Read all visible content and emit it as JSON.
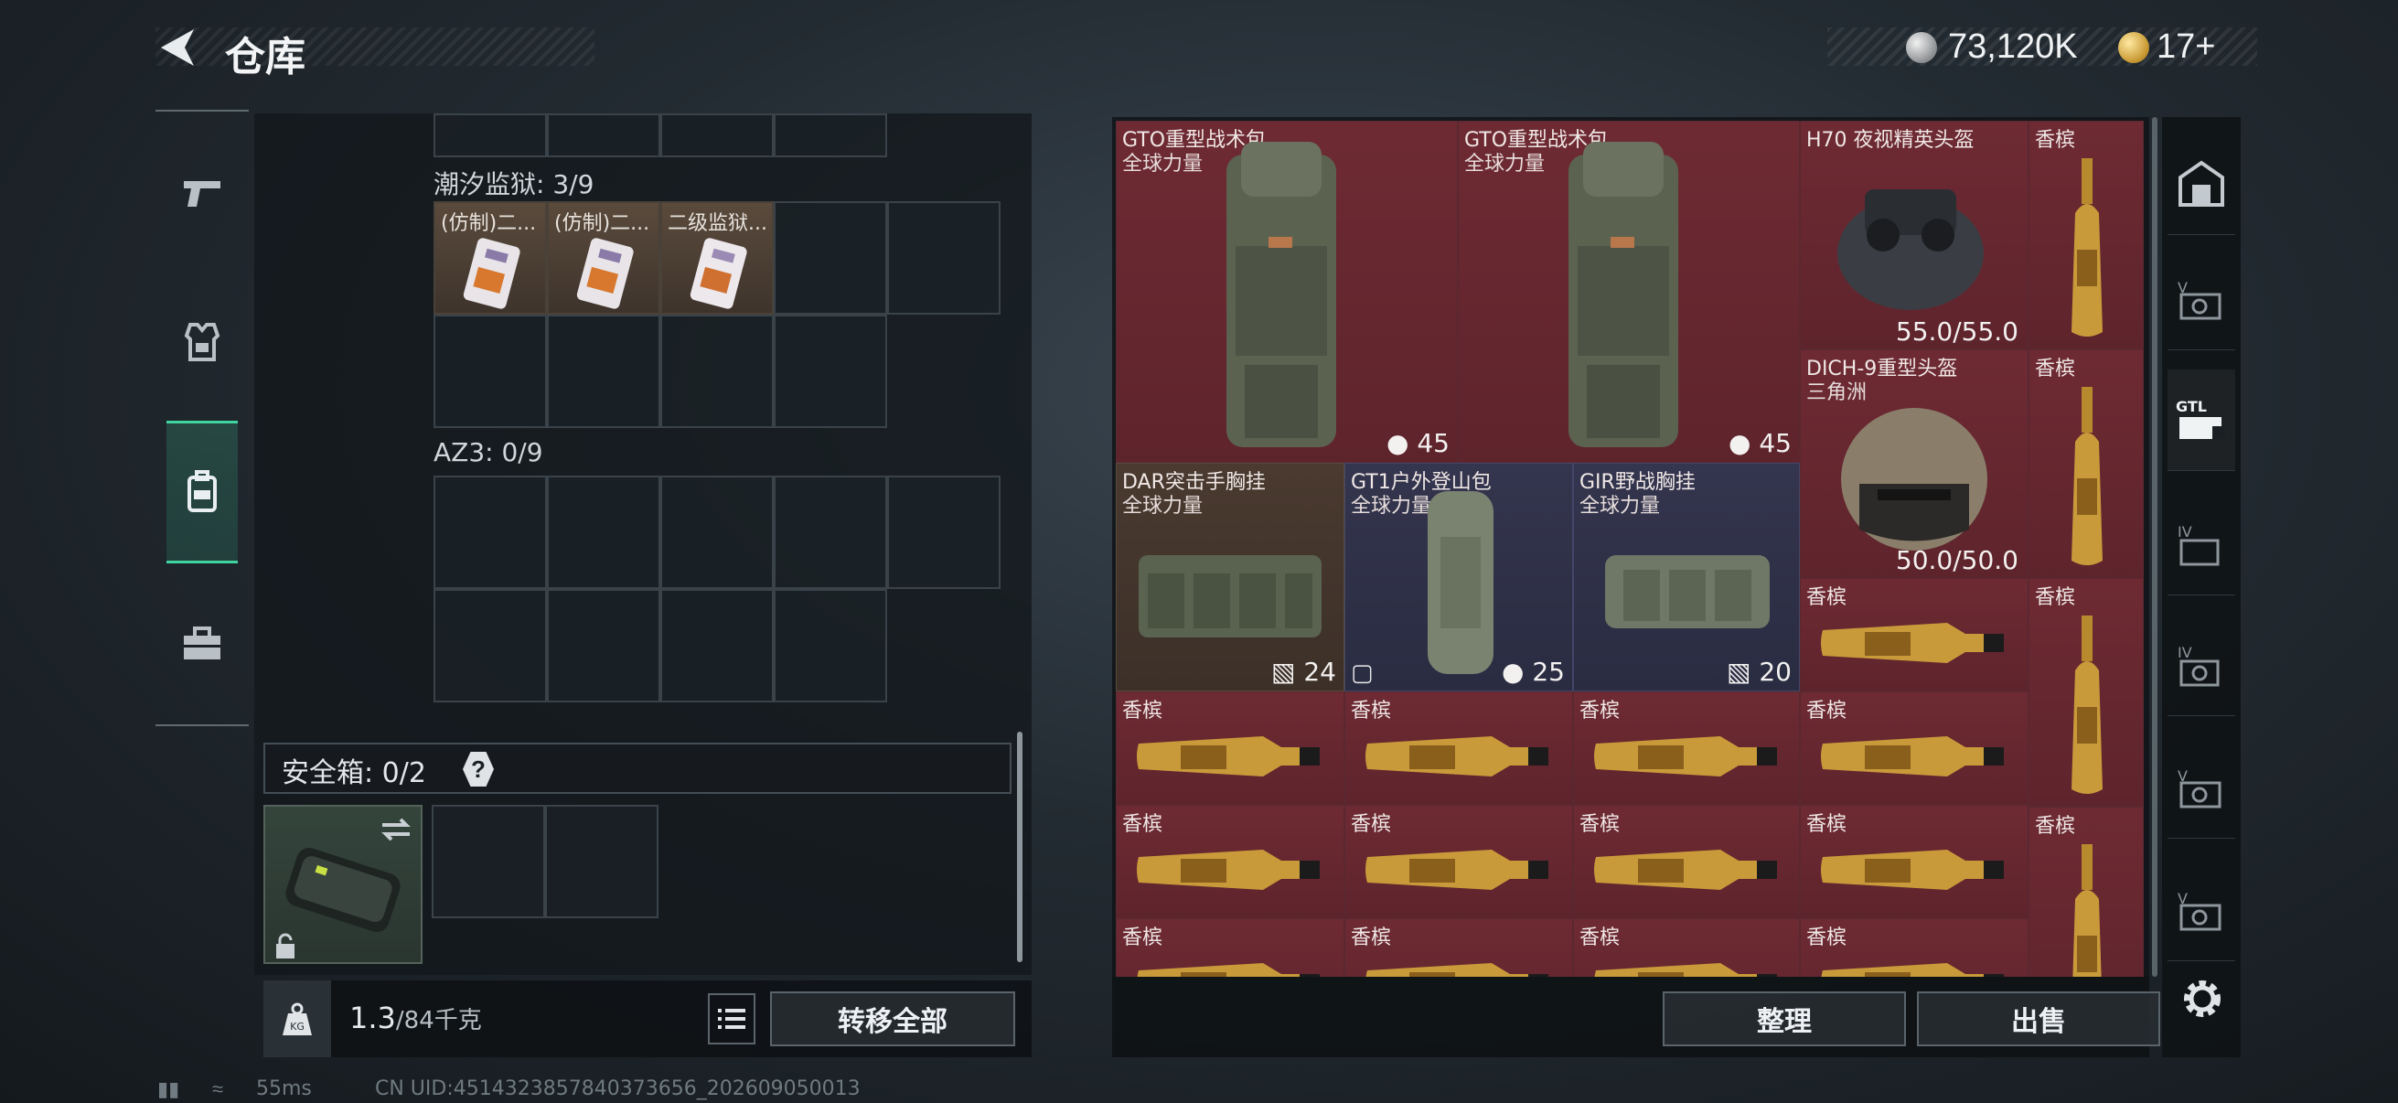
{
  "header": {
    "title": "仓库",
    "currency_silver": "73,120K",
    "currency_gold": "17+"
  },
  "left_rail": [
    "weapons",
    "armor",
    "backpack",
    "toolbox"
  ],
  "left_panel": {
    "section1_label": "潮汐监狱: 3/9",
    "section1_items": [
      "(仿制)二...",
      "(仿制)二...",
      "二级监狱..."
    ],
    "section2_label": "AZ3: 0/9",
    "safe_label": "安全箱: 0/2",
    "safe_help": "?",
    "weight_value": "1.3",
    "weight_capacity": "/84千克",
    "kg_label": "KG",
    "transfer_all": "转移全部"
  },
  "stash": {
    "items": [
      {
        "name": "GTO重型战术包",
        "sub": "全球力量",
        "cap": "45",
        "kind": "backpack"
      },
      {
        "name": "GTO重型战术包",
        "sub": "全球力量",
        "cap": "45",
        "kind": "backpack"
      },
      {
        "name": "H70 夜视精英头盔",
        "sub": "",
        "durability": "55.0/55.0",
        "kind": "helmet-nv"
      },
      {
        "name": "DICH-9重型头盔",
        "sub": "三角洲",
        "durability": "50.0/50.0",
        "kind": "helmet"
      },
      {
        "name": "DAR突击手胸挂",
        "sub": "全球力量",
        "cap": "24",
        "kind": "vest"
      },
      {
        "name": "GT1户外登山包",
        "sub": "全球力量",
        "cap": "25",
        "kind": "pack"
      },
      {
        "name": "GIR野战胸挂",
        "sub": "全球力量",
        "cap": "20",
        "kind": "vest"
      },
      {
        "name": "香槟",
        "kind": "champagne"
      }
    ],
    "champagne_label": "香槟"
  },
  "actions": {
    "sort": "整理",
    "sell": "出售"
  },
  "status": {
    "ping": "55ms",
    "uid": "CN UID:451432385784037365​6_202609050013"
  },
  "colors": {
    "accent": "#3fd4a0",
    "slot_red": "#6e2a33",
    "slot_blue": "#34354e"
  }
}
